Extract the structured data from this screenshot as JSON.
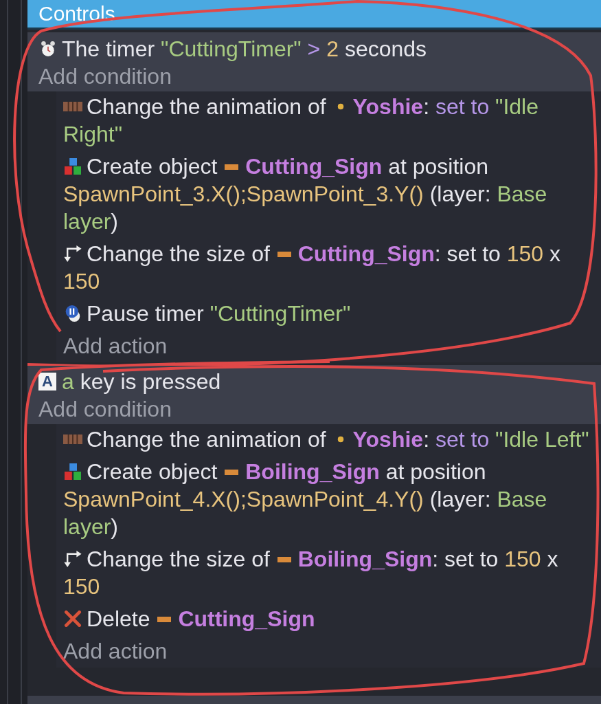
{
  "header": {
    "title": "Controls"
  },
  "events": [
    {
      "conditions": [
        {
          "kind": "timer",
          "segments": [
            {
              "kind": "text",
              "text": "The timer "
            },
            {
              "kind": "string",
              "text": "\"CuttingTimer\""
            },
            {
              "kind": "operator",
              "text": " > "
            },
            {
              "kind": "number",
              "text": "2"
            },
            {
              "kind": "text",
              "text": " seconds"
            }
          ]
        }
      ],
      "add_condition": "Add condition",
      "actions": [
        {
          "kind": "animation",
          "segments": [
            {
              "kind": "text",
              "text": "Change the animation of "
            },
            {
              "kind": "sprite_object",
              "text": "Yoshie"
            },
            {
              "kind": "text",
              "text": ": "
            },
            {
              "kind": "operator",
              "text": "set to "
            },
            {
              "kind": "string",
              "text": "\"Idle Right\""
            }
          ]
        },
        {
          "kind": "create",
          "segments": [
            {
              "kind": "text",
              "text": "Create object "
            },
            {
              "kind": "sign_object",
              "text": "Cutting_Sign"
            },
            {
              "kind": "text",
              "text": " at position "
            },
            {
              "kind": "number",
              "text": "SpawnPoint_3.X();SpawnPoint_3.Y()"
            },
            {
              "kind": "text",
              "text": " (layer: "
            },
            {
              "kind": "string",
              "text": "Base layer"
            },
            {
              "kind": "text",
              "text": ")"
            }
          ]
        },
        {
          "kind": "resize",
          "segments": [
            {
              "kind": "text",
              "text": "Change the size of "
            },
            {
              "kind": "sign_object",
              "text": "Cutting_Sign"
            },
            {
              "kind": "text",
              "text": ": set to "
            },
            {
              "kind": "number",
              "text": "150"
            },
            {
              "kind": "text",
              "text": " x "
            },
            {
              "kind": "number",
              "text": "150"
            }
          ]
        },
        {
          "kind": "pause",
          "segments": [
            {
              "kind": "text",
              "text": "Pause timer "
            },
            {
              "kind": "string",
              "text": "\"CuttingTimer\""
            }
          ]
        }
      ],
      "add_action": "Add action"
    },
    {
      "conditions": [
        {
          "kind": "key",
          "icon_text": "A",
          "segments": [
            {
              "kind": "string",
              "text": "a"
            },
            {
              "kind": "text",
              "text": " key is pressed"
            }
          ]
        }
      ],
      "add_condition": "Add condition",
      "actions": [
        {
          "kind": "animation",
          "segments": [
            {
              "kind": "text",
              "text": "Change the animation of "
            },
            {
              "kind": "sprite_object",
              "text": "Yoshie"
            },
            {
              "kind": "text",
              "text": ": "
            },
            {
              "kind": "operator",
              "text": "set to "
            },
            {
              "kind": "string",
              "text": "\"Idle Left\""
            }
          ]
        },
        {
          "kind": "create",
          "segments": [
            {
              "kind": "text",
              "text": "Create object "
            },
            {
              "kind": "sign_object",
              "text": "Boiling_Sign"
            },
            {
              "kind": "text",
              "text": " at position "
            },
            {
              "kind": "number",
              "text": "SpawnPoint_4.X();SpawnPoint_4.Y()"
            },
            {
              "kind": "text",
              "text": " (layer: "
            },
            {
              "kind": "string",
              "text": "Base layer"
            },
            {
              "kind": "text",
              "text": ")"
            }
          ]
        },
        {
          "kind": "resize",
          "segments": [
            {
              "kind": "text",
              "text": "Change the size of "
            },
            {
              "kind": "sign_object",
              "text": "Boiling_Sign"
            },
            {
              "kind": "text",
              "text": ": set to "
            },
            {
              "kind": "number",
              "text": "150"
            },
            {
              "kind": "text",
              "text": " x "
            },
            {
              "kind": "number",
              "text": "150"
            }
          ]
        },
        {
          "kind": "delete",
          "segments": [
            {
              "kind": "text",
              "text": "Delete "
            },
            {
              "kind": "sign_object",
              "text": "Cutting_Sign"
            }
          ]
        }
      ],
      "add_action": "Add action"
    }
  ]
}
